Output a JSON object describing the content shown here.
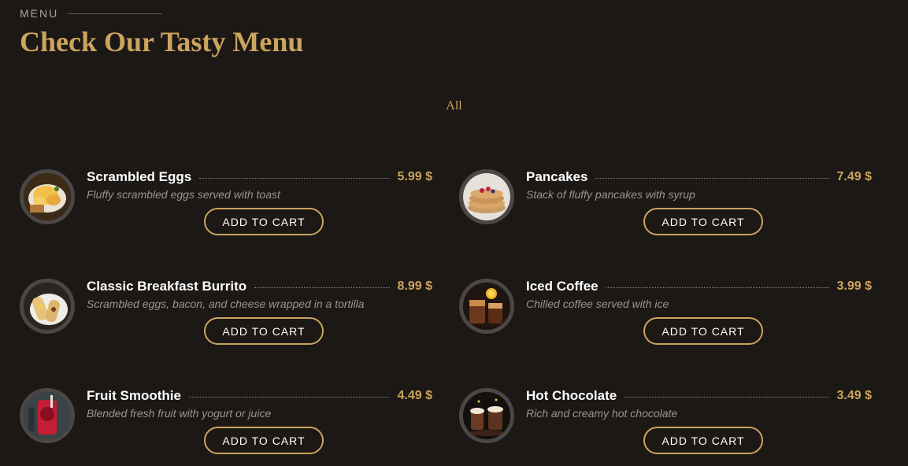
{
  "header": {
    "section_label": "MENU",
    "title": "Check Our Tasty Menu"
  },
  "filters": {
    "active": "All"
  },
  "menu": {
    "items": [
      {
        "name": "Scrambled Eggs",
        "price": "5.99 $",
        "description": "Fluffy scrambled eggs served with toast",
        "cart_label": "ADD TO CART",
        "image": "scrambled-eggs"
      },
      {
        "name": "Pancakes",
        "price": "7.49 $",
        "description": "Stack of fluffy pancakes with syrup",
        "cart_label": "ADD TO CART",
        "image": "pancakes"
      },
      {
        "name": "Classic Breakfast Burrito",
        "price": "8.99 $",
        "description": "Scrambled eggs, bacon, and cheese wrapped in a tortilla",
        "cart_label": "ADD TO CART",
        "image": "breakfast-burrito"
      },
      {
        "name": "Iced Coffee",
        "price": "3.99 $",
        "description": "Chilled coffee served with ice",
        "cart_label": "ADD TO CART",
        "image": "iced-coffee"
      },
      {
        "name": "Fruit Smoothie",
        "price": "4.49 $",
        "description": "Blended fresh fruit with yogurt or juice",
        "cart_label": "ADD TO CART",
        "image": "fruit-smoothie"
      },
      {
        "name": "Hot Chocolate",
        "price": "3.49 $",
        "description": "Rich and creamy hot chocolate",
        "cart_label": "ADD TO CART",
        "image": "hot-chocolate"
      }
    ]
  },
  "colors": {
    "accent": "#cda45e",
    "background": "#1b1815",
    "text": "#ffffff",
    "muted": "#9a9590"
  }
}
